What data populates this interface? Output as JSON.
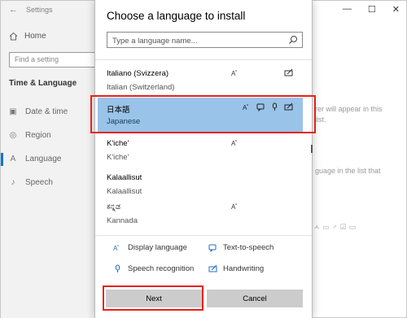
{
  "settings": {
    "window_title": "Settings",
    "home_label": "Home",
    "find_placeholder": "Find a setting",
    "section_label": "Time & Language",
    "nav_items": [
      {
        "label": "Date & time",
        "icon": "calendar-clock-icon"
      },
      {
        "label": "Region",
        "icon": "region-icon"
      },
      {
        "label": "Language",
        "icon": "language-icon",
        "selected": true
      },
      {
        "label": "Speech",
        "icon": "microphone-icon"
      }
    ],
    "bg_text_1": "rer will appear in this",
    "bg_text_2": "list.",
    "bg_text_3": "guage in the list that"
  },
  "dialog": {
    "title": "Choose a language to install",
    "search_placeholder": "Type a language name...",
    "languages": [
      {
        "name": "Italiano (Svizzera)",
        "sub": "Italian (Switzerland)",
        "features": [
          "display-language",
          "handwriting"
        ]
      },
      {
        "name": "日本語",
        "sub": "Japanese",
        "features": [
          "display-language",
          "text-to-speech",
          "speech-recognition",
          "handwriting"
        ],
        "selected": true
      },
      {
        "name": "K'iche'",
        "sub": "K'iche'",
        "features": [
          "display-language"
        ]
      },
      {
        "name": "Kalaallisut",
        "sub": "Kalaallisut",
        "features": []
      },
      {
        "name": "ಕನ್ನಡ",
        "sub": "Kannada",
        "features": [
          "display-language"
        ]
      }
    ],
    "legend": {
      "display_language": "Display language",
      "text_to_speech": "Text-to-speech",
      "speech_recognition": "Speech recognition",
      "handwriting": "Handwriting"
    },
    "next_label": "Next",
    "cancel_label": "Cancel"
  },
  "colors": {
    "selection": "#99c3e8",
    "highlight_outline": "#e8201b",
    "accent": "#0078d7",
    "button": "#cccccc"
  }
}
